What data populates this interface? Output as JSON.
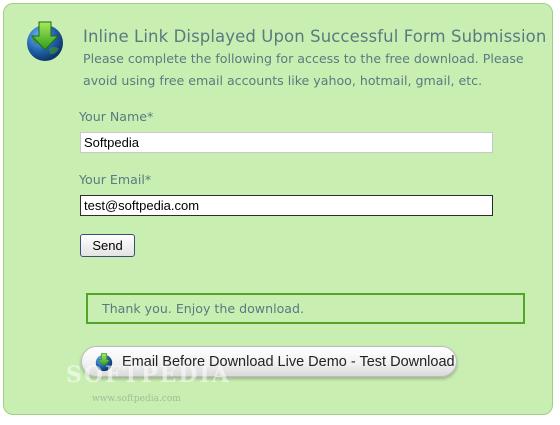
{
  "header": {
    "title": "Inline Link Displayed Upon Successful Form Submission",
    "description": "Please complete the following for access to the free download. Please avoid using free email accounts like yahoo, hotmail, gmail, etc.",
    "icon": "globe-download-icon"
  },
  "form": {
    "name_label": "Your Name*",
    "name_value": "Softpedia",
    "email_label": "Your Email*",
    "email_value": "test@softpedia.com",
    "send_label": "Send"
  },
  "message": {
    "text": "Thank you. Enjoy the download."
  },
  "download_button": {
    "label": "Email Before Download Live Demo - Test Download",
    "icon": "globe-download-icon"
  },
  "watermark": {
    "brand": "SOFTPEDIA",
    "url": "www.softpedia.com"
  },
  "colors": {
    "panel_bg": "#c9eeb2",
    "text": "#5b7a80",
    "success_border": "#55a42a"
  }
}
